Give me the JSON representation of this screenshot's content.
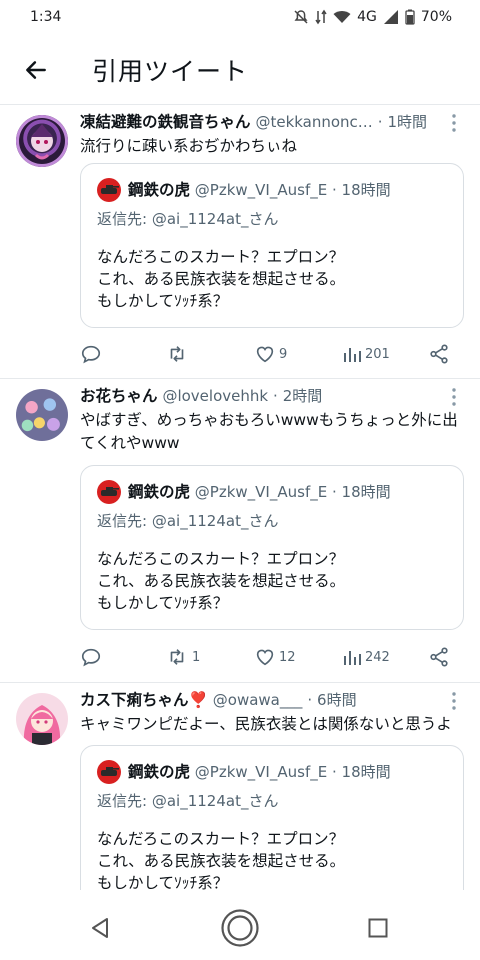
{
  "status": {
    "time": "1:34",
    "network": "4G",
    "battery": "70%"
  },
  "header": {
    "title": "引用ツイート"
  },
  "tweets": [
    {
      "name": "凍結避難の鉄観音ちゃん",
      "handle": "@tekkannonc…",
      "sep": "·",
      "time": "1時間",
      "text": "流行りに疎い系おぢかわちぃね",
      "quote": {
        "name": "鋼鉄の虎",
        "handle": "@Pzkw_VI_Ausf_E",
        "sep": "·",
        "time": "18時間",
        "reply_prefix": "返信先:",
        "reply_target": "@ai_1124at_さん",
        "lines": [
          "なんだろこのスカート？エプロン？",
          "これ、ある民族衣装を想起させる。",
          "もしかしてｿｯﾁ系？"
        ]
      },
      "retweets": "",
      "likes": "9",
      "views": "201"
    },
    {
      "name": "お花ちゃん",
      "handle": "@lovelovehhk",
      "sep": "·",
      "time": "2時間",
      "text": "やばすぎ、めっちゃおもろいwwwもうちょっと外に出てくれやwww",
      "quote": {
        "name": "鋼鉄の虎",
        "handle": "@Pzkw_VI_Ausf_E",
        "sep": "·",
        "time": "18時間",
        "reply_prefix": "返信先:",
        "reply_target": "@ai_1124at_さん",
        "lines": [
          "なんだろこのスカート？エプロン？",
          "これ、ある民族衣装を想起させる。",
          "もしかしてｿｯﾁ系？"
        ]
      },
      "retweets": "1",
      "likes": "12",
      "views": "242"
    },
    {
      "name": "カス下痢ちゃん",
      "name_emoji": "❣️",
      "handle": "@owawa___",
      "sep": "·",
      "time": "6時間",
      "text": "キャミワンピだよー、民族衣装とは関係ないと思うよ",
      "quote": {
        "name": "鋼鉄の虎",
        "handle": "@Pzkw_VI_Ausf_E",
        "sep": "·",
        "time": "18時間",
        "reply_prefix": "返信先:",
        "reply_target": "@ai_1124at_さん",
        "lines": [
          "なんだろこのスカート？エプロン？",
          "これ、ある民族衣装を想起させる。",
          "もしかしてｿｯﾁ系？"
        ]
      }
    }
  ],
  "colors": {
    "text": "#0f1419",
    "secondary": "#536471",
    "divider": "#e6e9ec",
    "heart_accent": "#e0245e"
  },
  "icons": [
    "back-arrow-icon",
    "reply-icon",
    "retweet-icon",
    "like-icon",
    "views-icon",
    "share-icon",
    "more-icon",
    "nav-back-icon",
    "nav-home-icon",
    "nav-recents-icon"
  ]
}
